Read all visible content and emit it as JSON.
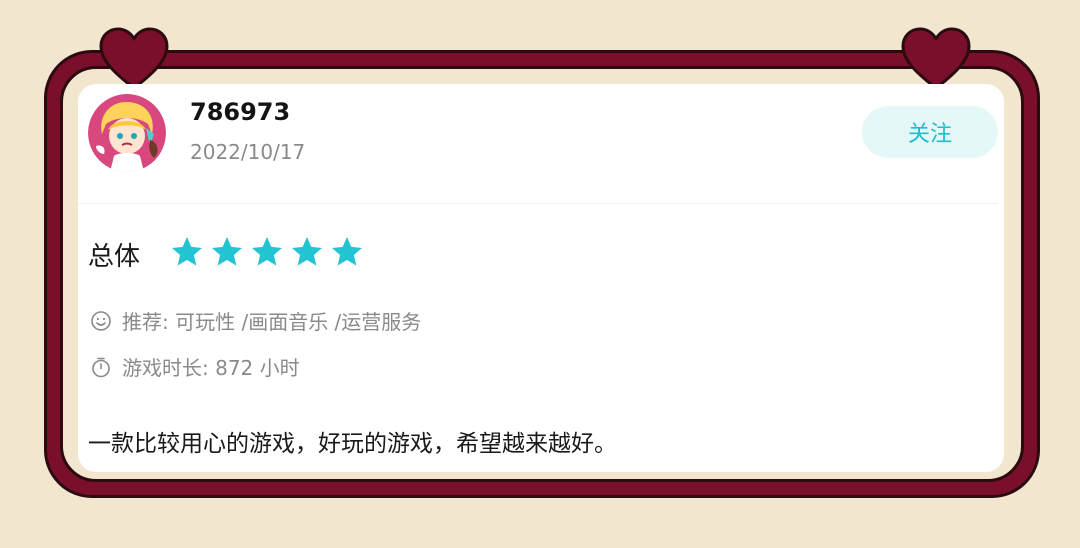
{
  "user": {
    "name": "786973",
    "date": "2022/10/17",
    "follow_label": "关注"
  },
  "rating": {
    "label": "总体",
    "stars": 5,
    "max": 5,
    "star_color": "#22c3d3"
  },
  "meta": {
    "recommend_icon": "smiley-icon",
    "recommend": "推荐: 可玩性 /画面音乐 /运营服务",
    "playtime_icon": "stopwatch-icon",
    "playtime": "游戏时长: 872 小时"
  },
  "review": {
    "text": "一款比较用心的游戏，好玩的游戏，希望越来越好。"
  },
  "colors": {
    "frame": "#7a0f2b",
    "background": "#f3e6cf",
    "accent": "#18bfd0"
  }
}
